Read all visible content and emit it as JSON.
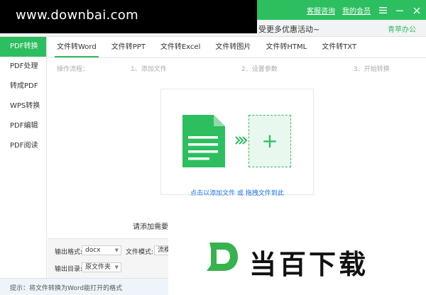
{
  "watermark_top": {
    "text": "www.downbai.com"
  },
  "titlebar": {
    "service_link": "客服咨询",
    "member_link": "我的会员"
  },
  "promo": {
    "text": "更多优惠活动~",
    "right_text": "青苹办公",
    "partial_prefix": "受"
  },
  "sidebar": {
    "items": [
      {
        "label": "PDF转换",
        "active": true
      },
      {
        "label": "PDF处理"
      },
      {
        "label": "转成PDF"
      },
      {
        "label": "WPS转换"
      },
      {
        "label": "PDF编辑"
      },
      {
        "label": "PDF阅读"
      }
    ]
  },
  "tabs": [
    {
      "label": "文件转Word",
      "active": true
    },
    {
      "label": "文件转PPT"
    },
    {
      "label": "文件转Excel"
    },
    {
      "label": "文件转图片"
    },
    {
      "label": "文件转HTML"
    },
    {
      "label": "文件转TXT"
    }
  ],
  "steps": {
    "label": "操作流程：",
    "step1": "1、添加文件",
    "step2": "2、设置参数",
    "step3": "3、开始转换"
  },
  "drop": {
    "link_text": "点击以添加文件",
    "or_text": " 或 ",
    "drag_text": "拖拽文件到此"
  },
  "add_tip": "请添加需要转",
  "options": {
    "format_label": "输出格式:",
    "format_value": "docx",
    "mode_label": "文件模式:",
    "mode_value": "流模",
    "dir_label": "输出目录:",
    "dir_value": "原文件夹"
  },
  "status": {
    "text": "提示：将文件转换为Word能打开的格式"
  },
  "watermark_bottom": {
    "logo_letter": "D",
    "text": "当百下载"
  },
  "colors": {
    "accent": "#2dbe60",
    "link": "#1a73e8"
  }
}
